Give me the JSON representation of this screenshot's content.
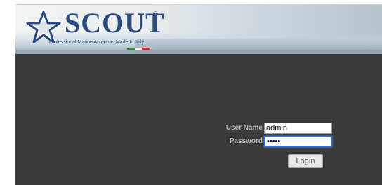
{
  "header": {
    "brand": "SCOUT",
    "registered_mark": "®",
    "tagline": "Professional Marine Antennas Made In Italy",
    "flag_colors": [
      "#2e8b3e",
      "#f4f4f4",
      "#c9302c"
    ],
    "brand_color": "#2b4a7e"
  },
  "login": {
    "username_label": "User Name",
    "username_value": "admin",
    "password_label": "Password",
    "password_value": "•••••",
    "submit_label": "Login"
  }
}
